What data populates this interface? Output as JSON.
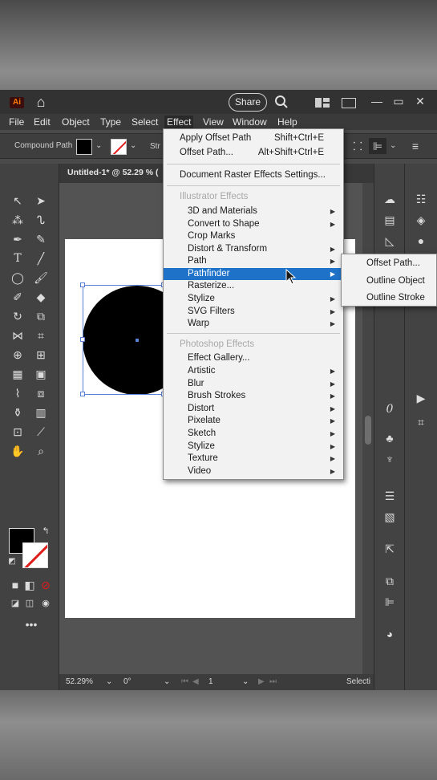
{
  "window": {
    "logo": "Ai",
    "share_label": "Share",
    "min": "—",
    "max": "▭",
    "close": "✕"
  },
  "menubar": [
    "File",
    "Edit",
    "Object",
    "Type",
    "Select",
    "Effect",
    "View",
    "Window",
    "Help"
  ],
  "control_bar": {
    "selection_type": "Compound Path",
    "stroke_label": "Str"
  },
  "document_tab": "Untitled-1* @ 52.29 % (",
  "effect_menu": {
    "apply_offset": {
      "label": "Apply Offset Path",
      "shortcut": "Shift+Ctrl+E"
    },
    "offset_path": {
      "label": "Offset Path...",
      "shortcut": "Alt+Shift+Ctrl+E"
    },
    "raster_settings": "Document Raster Effects Settings...",
    "illustrator_header": "Illustrator Effects",
    "illustrator_items": [
      "3D and Materials",
      "Convert to Shape",
      "Crop Marks",
      "Distort & Transform",
      "Path",
      "Pathfinder",
      "Rasterize...",
      "Stylize",
      "SVG Filters",
      "Warp"
    ],
    "photoshop_header": "Photoshop Effects",
    "photoshop_items": [
      "Effect Gallery...",
      "Artistic",
      "Blur",
      "Brush Strokes",
      "Distort",
      "Pixelate",
      "Sketch",
      "Stylize",
      "Texture",
      "Video"
    ],
    "highlighted": "Pathfinder"
  },
  "pathfinder_submenu": [
    "Offset Path...",
    "Outline Object",
    "Outline Stroke"
  ],
  "status_bar": {
    "zoom": "52.29%",
    "rotation": "0°",
    "artboard": "1",
    "tool": "Selecti"
  },
  "colors": {
    "accent": "#1e73c8",
    "fill": "#000000",
    "stroke_none": "#e21b1b",
    "selection": "#5a7fd6"
  }
}
